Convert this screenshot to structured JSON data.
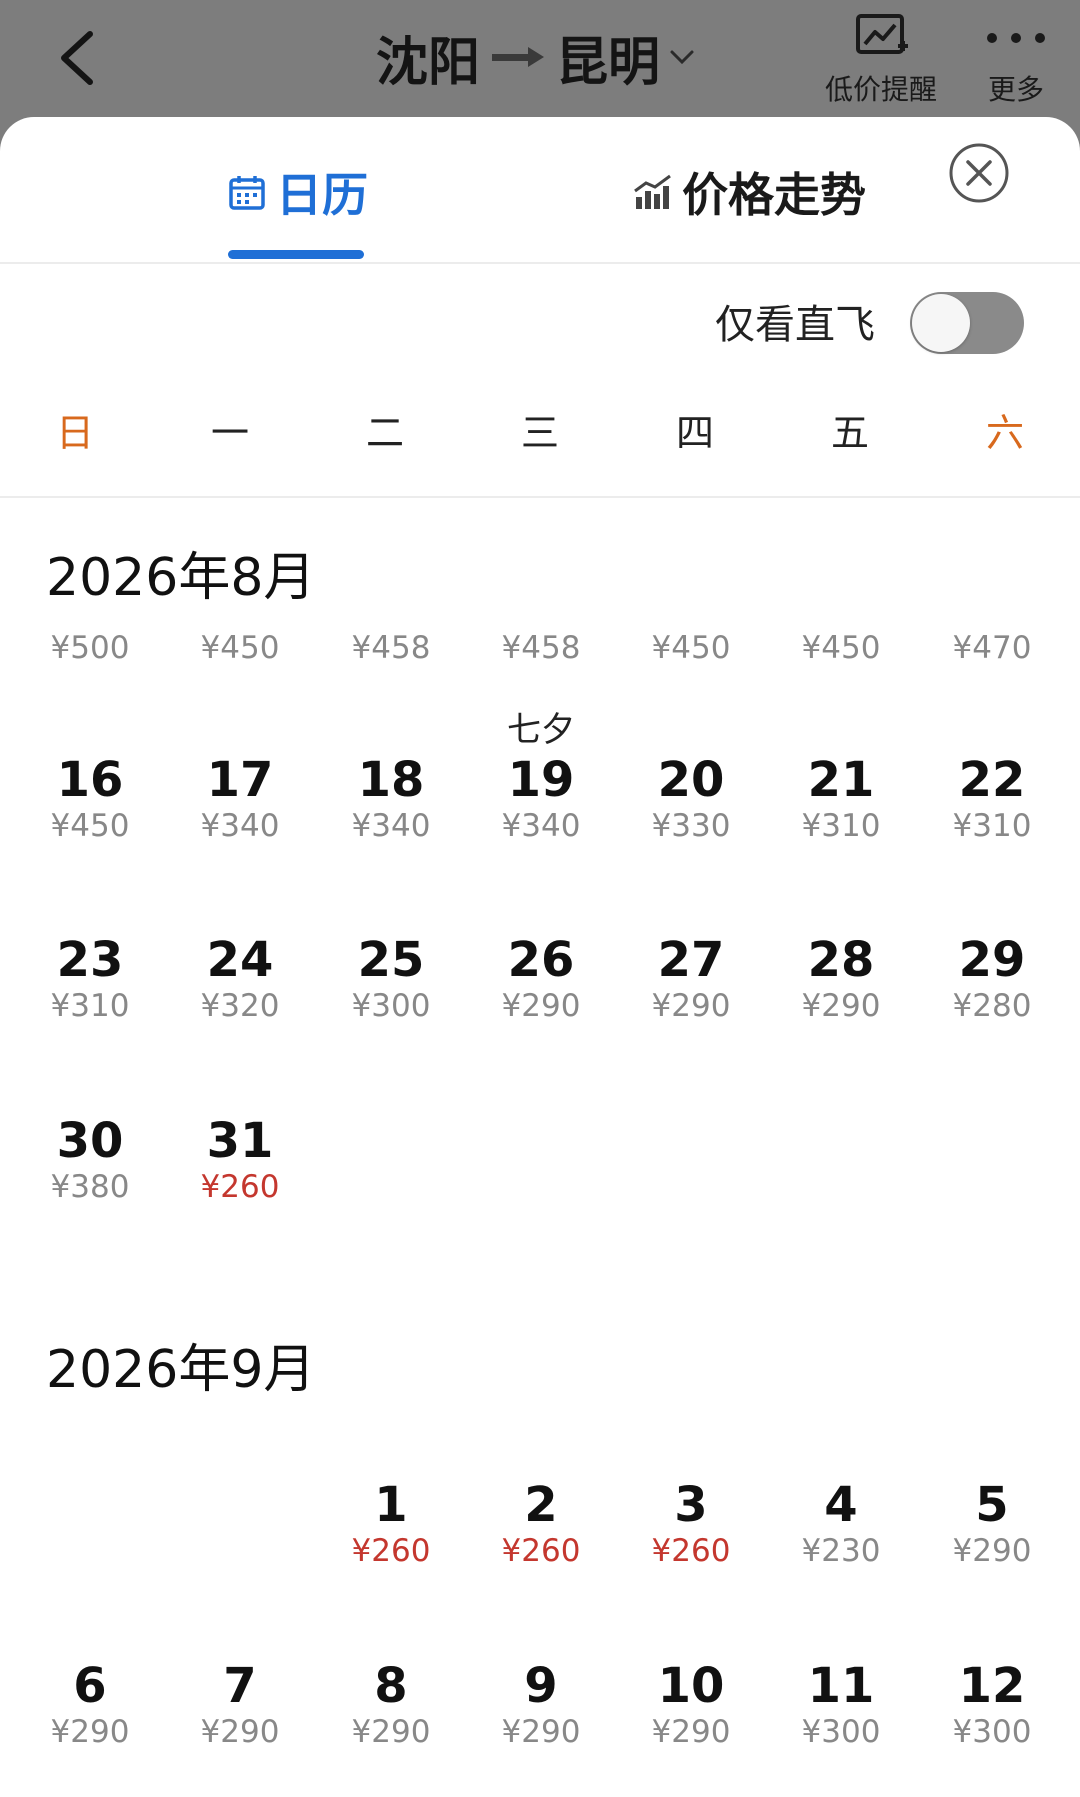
{
  "header": {
    "origin": "沈阳",
    "destination": "昆明",
    "tools": [
      {
        "label": "低价提醒",
        "icon": "price-alert-icon"
      },
      {
        "label": "更多",
        "icon": "more-icon"
      }
    ]
  },
  "tabs": [
    {
      "label": "日历",
      "icon": "calendar-icon",
      "active": true
    },
    {
      "label": "价格走势",
      "icon": "trend-chart-icon",
      "active": false
    }
  ],
  "filter": {
    "label": "仅看直飞",
    "on": false
  },
  "weekdays": [
    "日",
    "一",
    "二",
    "三",
    "四",
    "五",
    "六"
  ],
  "months": [
    {
      "title": "2026年8月",
      "partial_prices": [
        "¥500",
        "¥450",
        "¥458",
        "¥458",
        "¥450",
        "¥450",
        "¥470"
      ],
      "weeks": [
        [
          {
            "day": "16",
            "price": "¥450"
          },
          {
            "day": "17",
            "price": "¥340"
          },
          {
            "day": "18",
            "price": "¥340"
          },
          {
            "day": "19",
            "price": "¥340",
            "holiday": "七夕"
          },
          {
            "day": "20",
            "price": "¥330"
          },
          {
            "day": "21",
            "price": "¥310"
          },
          {
            "day": "22",
            "price": "¥310"
          }
        ],
        [
          {
            "day": "23",
            "price": "¥310"
          },
          {
            "day": "24",
            "price": "¥320"
          },
          {
            "day": "25",
            "price": "¥300"
          },
          {
            "day": "26",
            "price": "¥290"
          },
          {
            "day": "27",
            "price": "¥290"
          },
          {
            "day": "28",
            "price": "¥290"
          },
          {
            "day": "29",
            "price": "¥280"
          }
        ],
        [
          {
            "day": "30",
            "price": "¥380"
          },
          {
            "day": "31",
            "price": "¥260",
            "low": true
          },
          null,
          null,
          null,
          null,
          null
        ]
      ]
    },
    {
      "title": "2026年9月",
      "weeks": [
        [
          null,
          null,
          {
            "day": "1",
            "price": "¥260",
            "low": true
          },
          {
            "day": "2",
            "price": "¥260",
            "low": true
          },
          {
            "day": "3",
            "price": "¥260",
            "low": true
          },
          {
            "day": "4",
            "price": "¥230"
          },
          {
            "day": "5",
            "price": "¥290"
          }
        ],
        [
          {
            "day": "6",
            "price": "¥290"
          },
          {
            "day": "7",
            "price": "¥290"
          },
          {
            "day": "8",
            "price": "¥290"
          },
          {
            "day": "9",
            "price": "¥290"
          },
          {
            "day": "10",
            "price": "¥290"
          },
          {
            "day": "11",
            "price": "¥300"
          },
          {
            "day": "12",
            "price": "¥300"
          }
        ]
      ]
    }
  ],
  "colors": {
    "accent": "#1f6fd6",
    "weekend": "#d8691d",
    "low_price": "#c4372e",
    "price": "#888888"
  }
}
